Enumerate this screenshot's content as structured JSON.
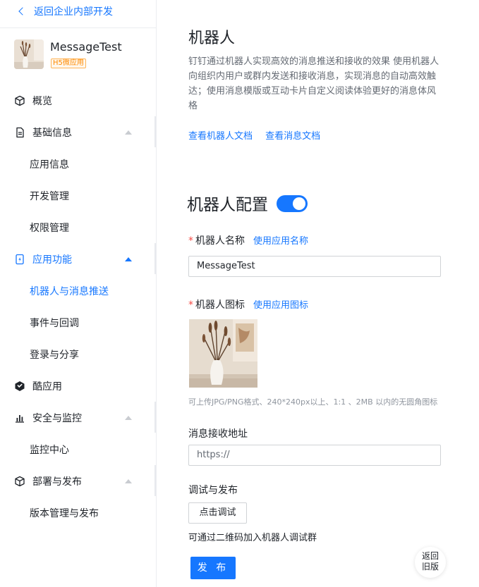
{
  "sidebar": {
    "back_label": "返回企业内部开发",
    "app": {
      "name": "MessageTest",
      "badge": "H5微应用"
    },
    "items": [
      {
        "label": "概览",
        "icon": "cube-icon"
      },
      {
        "label": "基础信息",
        "icon": "document-icon",
        "expanded": false
      },
      {
        "label": "应用信息"
      },
      {
        "label": "开发管理"
      },
      {
        "label": "权限管理"
      },
      {
        "label": "应用功能",
        "icon": "phone-lightning-icon",
        "expanded": true
      },
      {
        "label": "机器人与消息推送",
        "active": true
      },
      {
        "label": "事件与回调"
      },
      {
        "label": "登录与分享"
      },
      {
        "label": "酷应用",
        "icon": "cool-app-icon"
      },
      {
        "label": "安全与监控",
        "icon": "bar-chart-icon",
        "expanded": false
      },
      {
        "label": "监控中心"
      },
      {
        "label": "部署与发布",
        "icon": "cube-icon",
        "expanded": false
      },
      {
        "label": "版本管理与发布"
      }
    ]
  },
  "main": {
    "title": "机器人",
    "description": "钉钉通过机器人实现高效的消息推送和接收的效果 使用机器人向组织内用户或群内发送和接收消息，实现消息的自动高效触达；使用消息模版或互动卡片自定义阅读体验更好的消息体风格",
    "links": [
      "查看机器人文档",
      "查看消息文档"
    ],
    "config_title": "机器人配置",
    "toggle_on": true,
    "name_field": {
      "label": "机器人名称",
      "link": "使用应用名称",
      "value": "MessageTest"
    },
    "icon_field": {
      "label": "机器人图标",
      "link": "使用应用图标"
    },
    "icon_hint": "可上传JPG/PNG格式、240*240px以上、1:1 、2MB 以内的无圆角图标",
    "url_field": {
      "label": "消息接收地址",
      "placeholder": "https://"
    },
    "debug_section": {
      "label": "调试与发布",
      "button": "点击调试",
      "note": "可通过二维码加入机器人调试群"
    },
    "publish_button": "发 布"
  },
  "floating": {
    "old_version": "返回旧版"
  },
  "colors": {
    "accent": "#1677ff",
    "required": "#f54a45",
    "badge": "#ff8a00"
  }
}
